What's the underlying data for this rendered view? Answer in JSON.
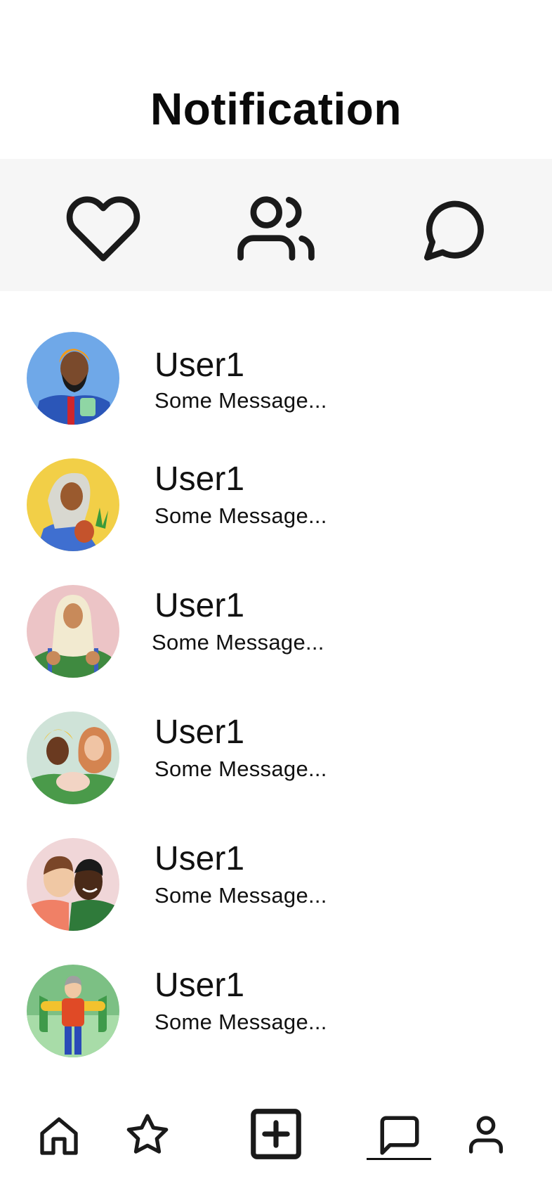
{
  "header": {
    "title": "Notification"
  },
  "tabs": [
    {
      "icon": "heart-icon"
    },
    {
      "icon": "users-icon"
    },
    {
      "icon": "message-circle-icon"
    }
  ],
  "notifications": [
    {
      "name": "User1",
      "message": "Some Message...",
      "avatar_bg": "#6fa8e8"
    },
    {
      "name": "User1",
      "message": "Some Message...",
      "avatar_bg": "#f2cf47"
    },
    {
      "name": "User1",
      "message": "Some Message...",
      "avatar_bg": "#ecc4c6"
    },
    {
      "name": "User1",
      "message": "Some Message...",
      "avatar_bg": "#cfe3d8"
    },
    {
      "name": "User1",
      "message": "Some Message...",
      "avatar_bg": "#f0d6d8"
    },
    {
      "name": "User1",
      "message": "Some Message...",
      "avatar_bg": "#7cc084"
    }
  ],
  "bottom_nav": {
    "items": [
      {
        "icon": "home-icon"
      },
      {
        "icon": "star-icon"
      },
      {
        "icon": "plus-square-icon"
      },
      {
        "icon": "message-square-icon",
        "active": true
      },
      {
        "icon": "user-icon"
      }
    ]
  }
}
